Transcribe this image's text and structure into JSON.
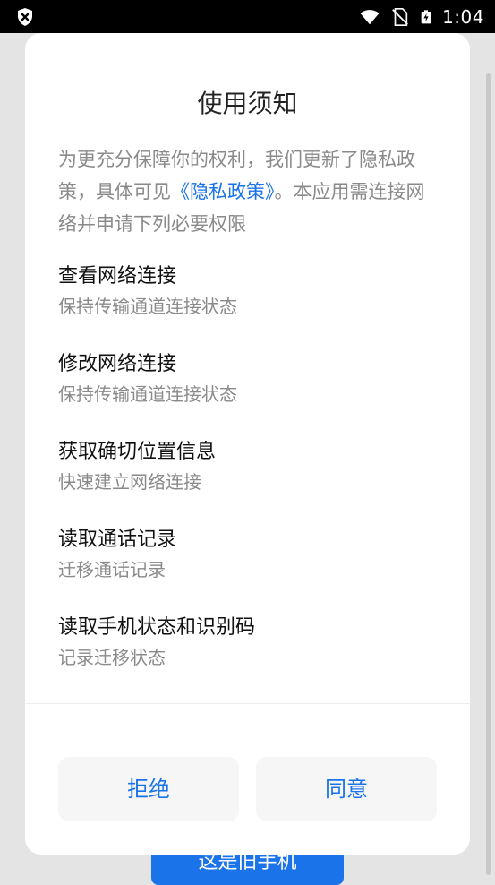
{
  "status_bar": {
    "time": "1:04",
    "icons": [
      "shield-x-icon",
      "wifi-icon",
      "no-sim-icon",
      "battery-charging-icon"
    ]
  },
  "dialog": {
    "title": "使用须知",
    "notice_before": "为更充分保障你的权利，我们更新了隐私政策，具体可见",
    "notice_link": "《隐私政策》",
    "notice_after": "。本应用需连接网络并申请下列必要权限",
    "permissions": [
      {
        "title": "查看网络连接",
        "desc": "保持传输通道连接状态"
      },
      {
        "title": "修改网络连接",
        "desc": "保持传输通道连接状态"
      },
      {
        "title": "获取确切位置信息",
        "desc": "快速建立网络连接"
      },
      {
        "title": "读取通话记录",
        "desc": "迁移通话记录"
      },
      {
        "title": "读取手机状态和识别码",
        "desc": "记录迁移状态"
      }
    ],
    "reject_label": "拒绝",
    "agree_label": "同意"
  },
  "background": {
    "button_label": "这是旧手机"
  },
  "colors": {
    "accent": "#1a73e8",
    "status_bar": "#000000",
    "overlay": "#e4e4e4"
  }
}
